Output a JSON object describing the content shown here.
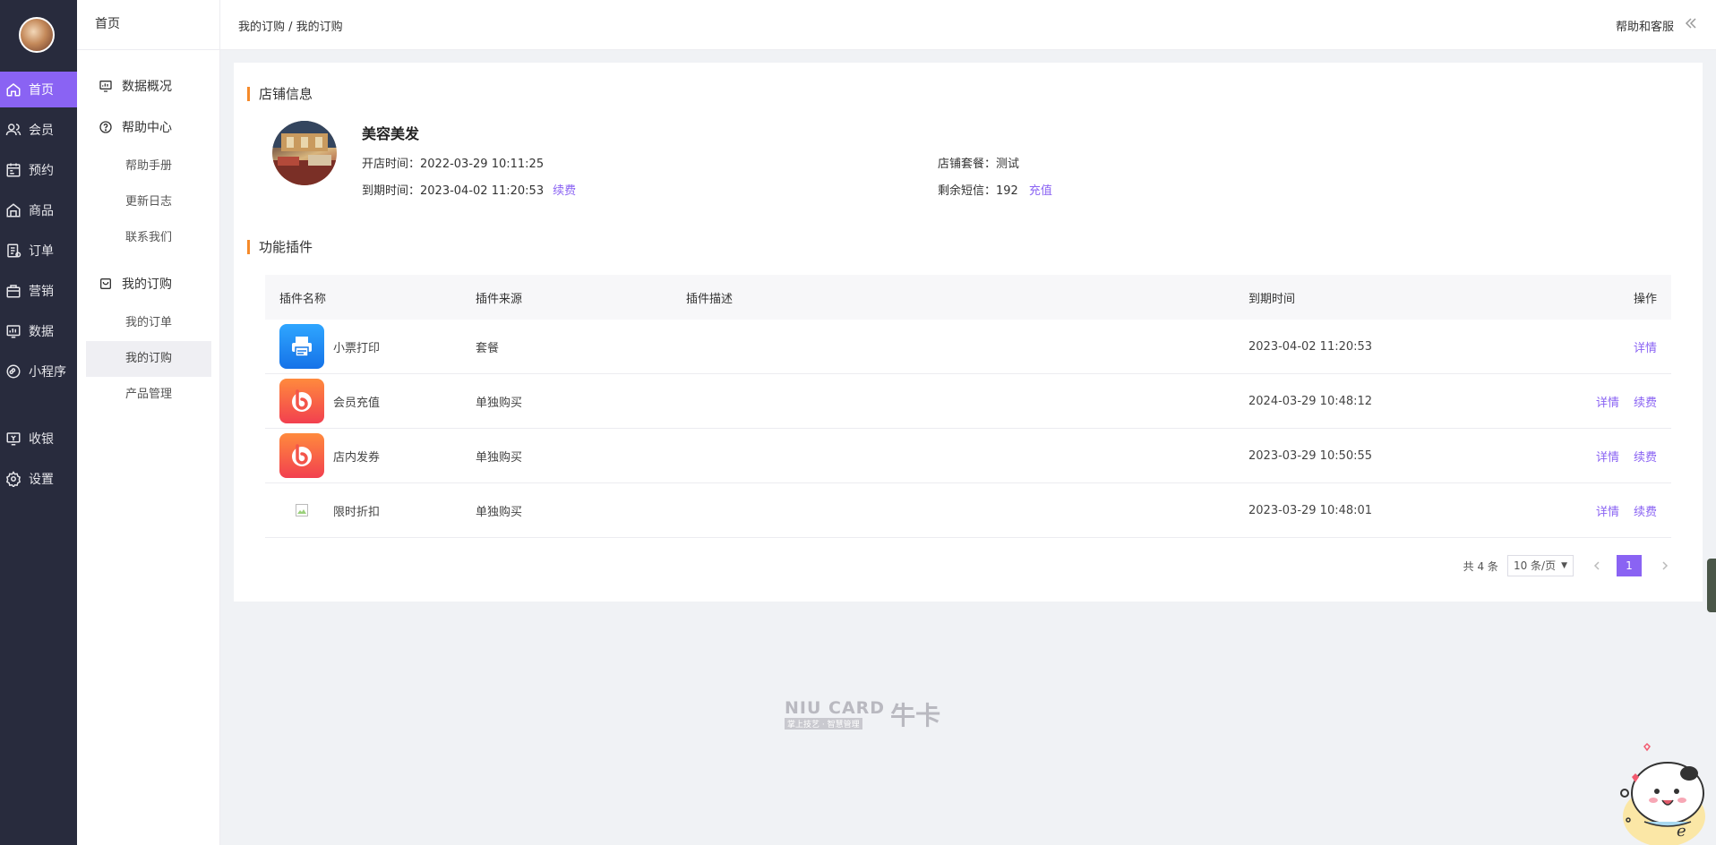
{
  "rail": {
    "items": [
      {
        "label": "首页",
        "icon": "home-icon",
        "active": true
      },
      {
        "label": "会员",
        "icon": "members-icon"
      },
      {
        "label": "预约",
        "icon": "booking-icon"
      },
      {
        "label": "商品",
        "icon": "goods-icon"
      },
      {
        "label": "订单",
        "icon": "orders-icon"
      },
      {
        "label": "营销",
        "icon": "marketing-icon"
      },
      {
        "label": "数据",
        "icon": "data-icon"
      },
      {
        "label": "小程序",
        "icon": "miniapp-icon"
      },
      {
        "label": "收银",
        "icon": "cashier-icon"
      },
      {
        "label": "设置",
        "icon": "settings-icon"
      }
    ]
  },
  "side": {
    "title": "首页",
    "groups": {
      "overview": "数据概况",
      "help_center": "帮助中心",
      "my_subscription": "我的订购"
    },
    "subs": {
      "manual": "帮助手册",
      "changelog": "更新日志",
      "contact": "联系我们",
      "my_orders": "我的订单",
      "my_subscription": "我的订购",
      "product_mgmt": "产品管理"
    }
  },
  "header": {
    "breadcrumb": "我的订购 / 我的订购",
    "help": "帮助和客服"
  },
  "shop": {
    "section_title": "店铺信息",
    "name": "美容美发",
    "open_label": "开店时间：",
    "open_time": "2022-03-29 10:11:25",
    "expire_label": "到期时间：",
    "expire_time": "2023-04-02 11:20:53",
    "renew_link": "续费",
    "package_label": "店铺套餐：",
    "package": "测试",
    "sms_label": "剩余短信：",
    "sms_count": "192",
    "recharge_link": "充值"
  },
  "plugins": {
    "section_title": "功能插件",
    "columns": {
      "name": "插件名称",
      "source": "插件来源",
      "desc": "插件描述",
      "expire": "到期时间",
      "op": "操作"
    },
    "rows": [
      {
        "name": "小票打印",
        "source": "套餐",
        "desc": "",
        "expire": "2023-04-02 11:20:53",
        "detail": "详情",
        "renew": ""
      },
      {
        "name": "会员充值",
        "source": "单独购买",
        "desc": "",
        "expire": "2024-03-29 10:48:12",
        "detail": "详情",
        "renew": "续费"
      },
      {
        "name": "店内发券",
        "source": "单独购买",
        "desc": "",
        "expire": "2023-03-29 10:50:55",
        "detail": "详情",
        "renew": "续费"
      },
      {
        "name": "限时折扣",
        "source": "单独购买",
        "desc": "",
        "expire": "2023-03-29 10:48:01",
        "detail": "详情",
        "renew": "续费"
      }
    ]
  },
  "pager": {
    "total": "共 4 条",
    "page_size": "10 条/页",
    "current": "1"
  },
  "brand": {
    "en": "NIU CARD",
    "tag": "掌上技艺 · 智慧管理",
    "cn": "牛卡"
  },
  "colors": {
    "accent": "#8a63f3",
    "rail_bg": "#282b3d",
    "section_mark": "#f58a2a"
  }
}
